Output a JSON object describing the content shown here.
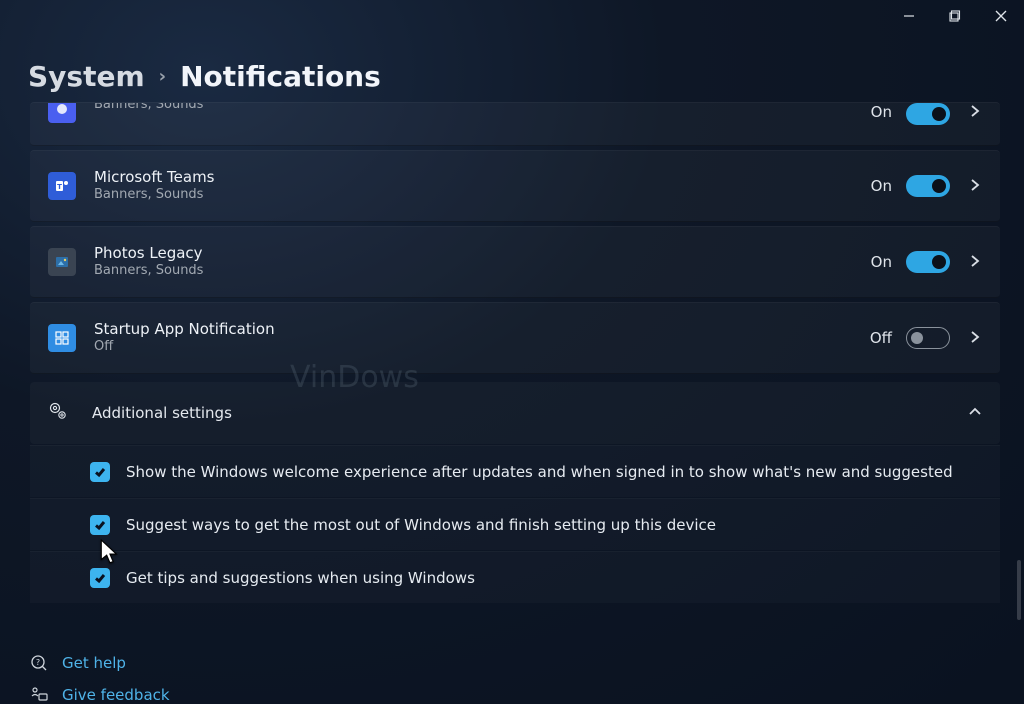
{
  "breadcrumb": {
    "parent": "System",
    "current": "Notifications"
  },
  "apps": [
    {
      "title": "",
      "sub": "Banners, Sounds",
      "state": "On",
      "on": true,
      "iconBg": "#4a5ff0"
    },
    {
      "title": "Microsoft Teams",
      "sub": "Banners, Sounds",
      "state": "On",
      "on": true,
      "iconBg": "#2f5dd8"
    },
    {
      "title": "Photos Legacy",
      "sub": "Banners, Sounds",
      "state": "On",
      "on": true,
      "iconBg": "#3a4452"
    },
    {
      "title": "Startup App Notification",
      "sub": "Off",
      "state": "Off",
      "on": false,
      "iconBg": "#2f8de3"
    }
  ],
  "additional": {
    "header": "Additional settings",
    "items": [
      "Show the Windows welcome experience after updates and when signed in to show what's new and suggested",
      "Suggest ways to get the most out of Windows and finish setting up this device",
      "Get tips and suggestions when using Windows"
    ]
  },
  "footer": {
    "help": "Get help",
    "feedback": "Give feedback"
  },
  "watermark": "VinDows"
}
